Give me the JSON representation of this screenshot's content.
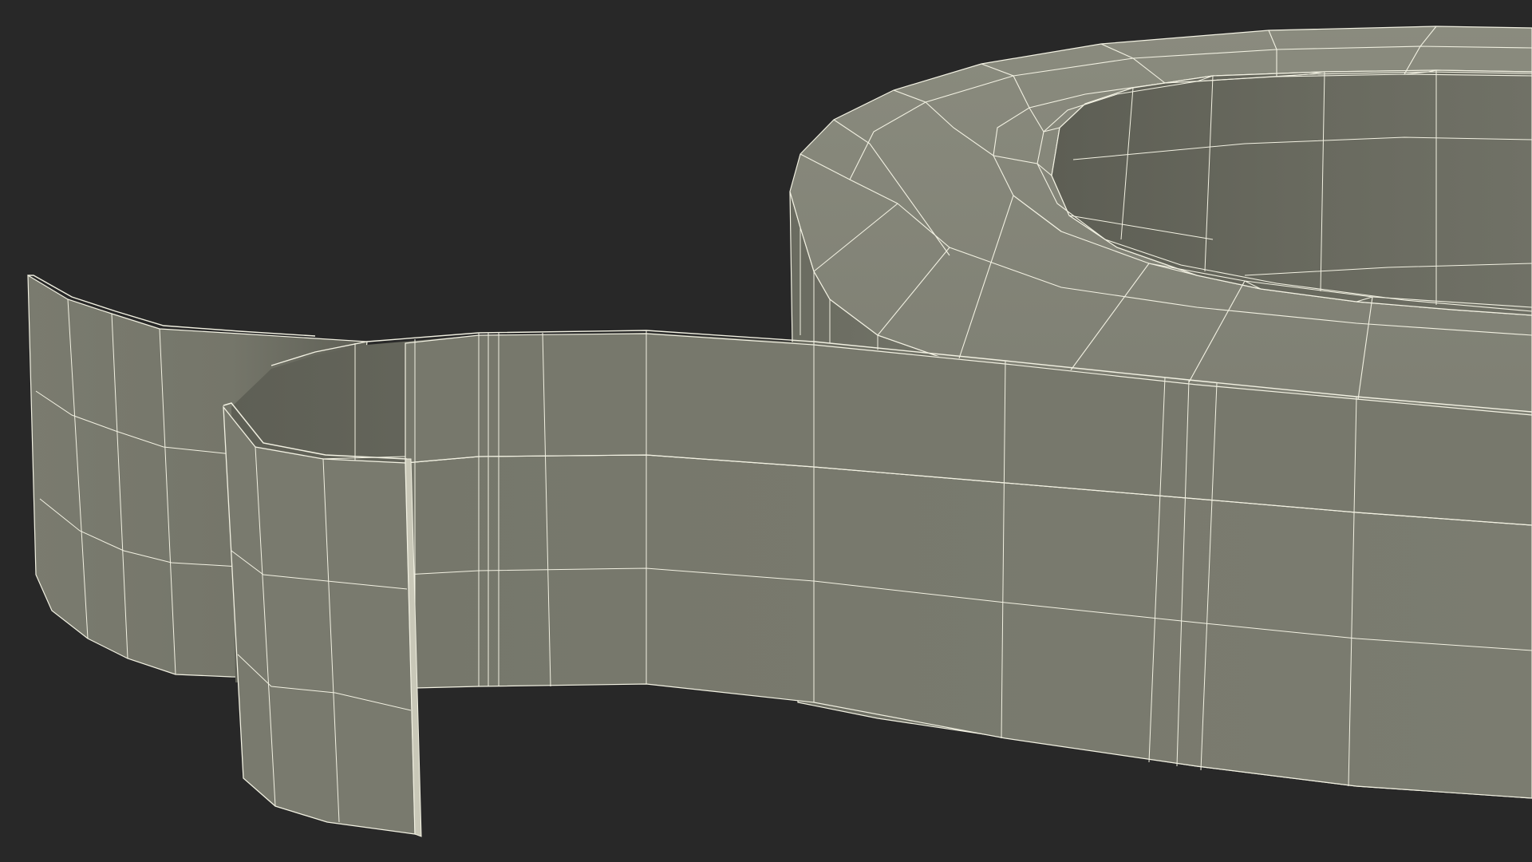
{
  "scene": {
    "background_color": "#282828",
    "surface_color": "#7a7b6f",
    "surface_shadow_color": "#65665b",
    "surface_light_color": "#8a8b7f",
    "wire_color": "#f2f1e2",
    "objects": [
      "ring-body",
      "ring-top-face",
      "ring-inner-wall",
      "tape-strip-back",
      "tape-strip-front"
    ]
  }
}
